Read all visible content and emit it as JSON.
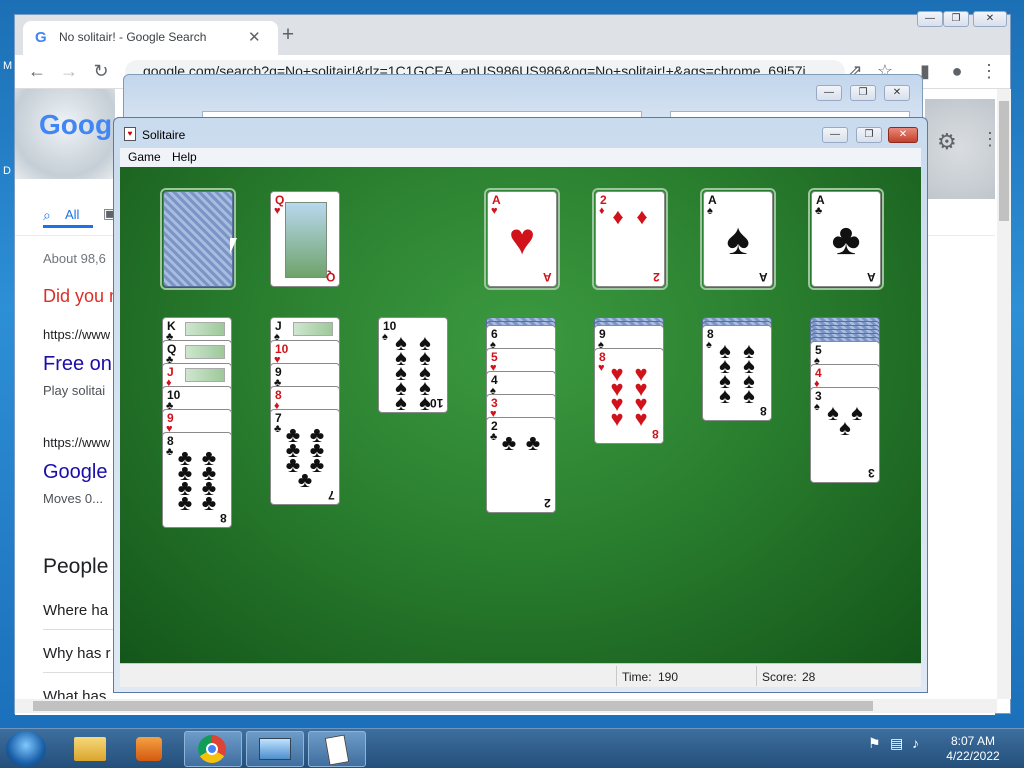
{
  "desktop": {
    "left_glimpse_1": "M",
    "left_glimpse_2": "D"
  },
  "chrome": {
    "tab_title": "No solitair! - Google Search",
    "tab_icon": "google-g-icon",
    "new_tab": "+",
    "url": "google.com/search?q=No+solitair!&rlz=1C1GCEA_enUS986US986&oq=No+solitair!+&aqs=chrome..69i57j",
    "window_min": "—",
    "window_max": "❐",
    "window_close": "✕",
    "content": {
      "logo": "Goog",
      "tab_all": "All",
      "about": "About 98,6",
      "did_you": "Did you m",
      "url1": "https://www",
      "free_on": "Free on",
      "play": "Play solitai",
      "url2": "https://www",
      "google": "Google",
      "moves": "Moves 0...",
      "people": "People",
      "q1": "Where ha",
      "q2": "Why has r",
      "q3": "What has"
    }
  },
  "solitaire": {
    "title": "Solitaire",
    "menu": [
      "Game",
      "Help"
    ],
    "status": {
      "time_label": "Time:",
      "time_value": "190",
      "score_label": "Score:",
      "score_value": "28"
    },
    "stock": {
      "face_down": true
    },
    "waste": [
      {
        "rank": "Q",
        "suit": "♥",
        "color": "red"
      }
    ],
    "foundations": [
      {
        "rank": "A",
        "suit": "♥",
        "color": "red"
      },
      {
        "rank": "2",
        "suit": "♦",
        "color": "red"
      },
      {
        "rank": "A",
        "suit": "♠",
        "color": "black"
      },
      {
        "rank": "A",
        "suit": "♣",
        "color": "black"
      }
    ],
    "tableau": [
      {
        "hidden": 0,
        "cards": [
          {
            "rank": "K",
            "suit": "♣",
            "color": "black"
          },
          {
            "rank": "Q",
            "suit": "♣",
            "color": "black"
          },
          {
            "rank": "J",
            "suit": "♦",
            "color": "red"
          },
          {
            "rank": "10",
            "suit": "♣",
            "color": "black"
          },
          {
            "rank": "9",
            "suit": "♥",
            "color": "red"
          },
          {
            "rank": "8",
            "suit": "♣",
            "color": "black"
          }
        ]
      },
      {
        "hidden": 0,
        "cards": [
          {
            "rank": "J",
            "suit": "♠",
            "color": "black"
          },
          {
            "rank": "10",
            "suit": "♥",
            "color": "red"
          },
          {
            "rank": "9",
            "suit": "♣",
            "color": "black"
          },
          {
            "rank": "8",
            "suit": "♦",
            "color": "red"
          },
          {
            "rank": "7",
            "suit": "♣",
            "color": "black"
          }
        ]
      },
      {
        "hidden": 0,
        "cards": [
          {
            "rank": "10",
            "suit": "♠",
            "color": "black"
          }
        ]
      },
      {
        "hidden": 2,
        "cards": [
          {
            "rank": "6",
            "suit": "♠",
            "color": "black"
          },
          {
            "rank": "5",
            "suit": "♥",
            "color": "red"
          },
          {
            "rank": "4",
            "suit": "♠",
            "color": "black"
          },
          {
            "rank": "3",
            "suit": "♥",
            "color": "red"
          },
          {
            "rank": "2",
            "suit": "♣",
            "color": "black"
          }
        ]
      },
      {
        "hidden": 2,
        "cards": [
          {
            "rank": "9",
            "suit": "♠",
            "color": "black"
          },
          {
            "rank": "8",
            "suit": "♥",
            "color": "red"
          }
        ]
      },
      {
        "hidden": 2,
        "cards": [
          {
            "rank": "8",
            "suit": "♠",
            "color": "black"
          }
        ]
      },
      {
        "hidden": 6,
        "cards": [
          {
            "rank": "5",
            "suit": "♠",
            "color": "black"
          },
          {
            "rank": "4",
            "suit": "♦",
            "color": "red"
          },
          {
            "rank": "3",
            "suit": "♠",
            "color": "black"
          }
        ]
      }
    ]
  },
  "taskbar": {
    "apps": [
      "explorer-icon",
      "media-player-icon",
      "chrome-icon",
      "control-panel-icon",
      "solitaire-icon"
    ],
    "clock_time": "8:07 AM",
    "clock_date": "4/22/2022"
  }
}
